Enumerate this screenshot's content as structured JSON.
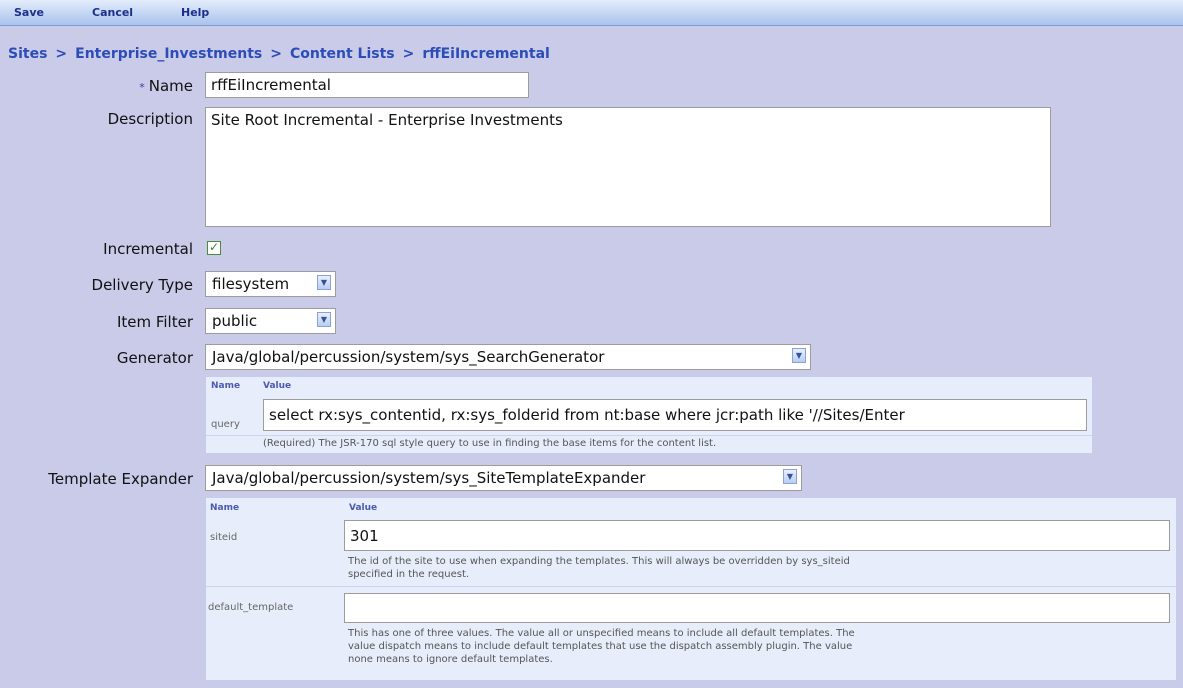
{
  "toolbar": {
    "save": "Save",
    "cancel": "Cancel",
    "help": "Help"
  },
  "breadcrumb": {
    "items": [
      "Sites",
      "Enterprise_Investments",
      "Content Lists",
      "rffEiIncremental"
    ],
    "separator": ">"
  },
  "form": {
    "name_required_marker": "*",
    "name_label": "Name",
    "name_value": "rffEiIncremental",
    "description_label": "Description",
    "description_value": "Site Root Incremental - Enterprise Investments",
    "incremental_label": "Incremental",
    "incremental_checked": true,
    "delivery_type_label": "Delivery Type",
    "delivery_type_value": "filesystem",
    "item_filter_label": "Item Filter",
    "item_filter_value": "public",
    "generator_label": "Generator",
    "generator_value": "Java/global/percussion/system/sys_SearchGenerator",
    "template_expander_label": "Template Expander",
    "template_expander_value": "Java/global/percussion/system/sys_SiteTemplateExpander"
  },
  "generator_params": {
    "header_name": "Name",
    "header_value": "Value",
    "rows": [
      {
        "name": "query",
        "value": "select rx:sys_contentid, rx:sys_folderid from nt:base where jcr:path like '//Sites/Enter",
        "hint": "(Required) The JSR-170 sql style query to use in finding the base items for the content list."
      }
    ]
  },
  "expander_params": {
    "header_name": "Name",
    "header_value": "Value",
    "rows": [
      {
        "name": "siteid",
        "value": "301",
        "hint_line1": "The id of the site to use when expanding the templates. This will always be overridden by sys_siteid",
        "hint_line2": "specified in the request."
      },
      {
        "name": "default_template",
        "value": "",
        "hint_line1": "This has one of three values. The value all or unspecified means to include all default templates. The",
        "hint_line2": "value dispatch means to include default templates that use the dispatch assembly plugin. The value",
        "hint_line3": "none means to ignore default templates."
      }
    ]
  },
  "icons": {
    "dropdown": "chevron-down-icon",
    "check": "checkmark-icon"
  },
  "colors": {
    "background": "#c9cbe9",
    "link": "#2c4db7",
    "toolbar": "#a9c3ec"
  }
}
